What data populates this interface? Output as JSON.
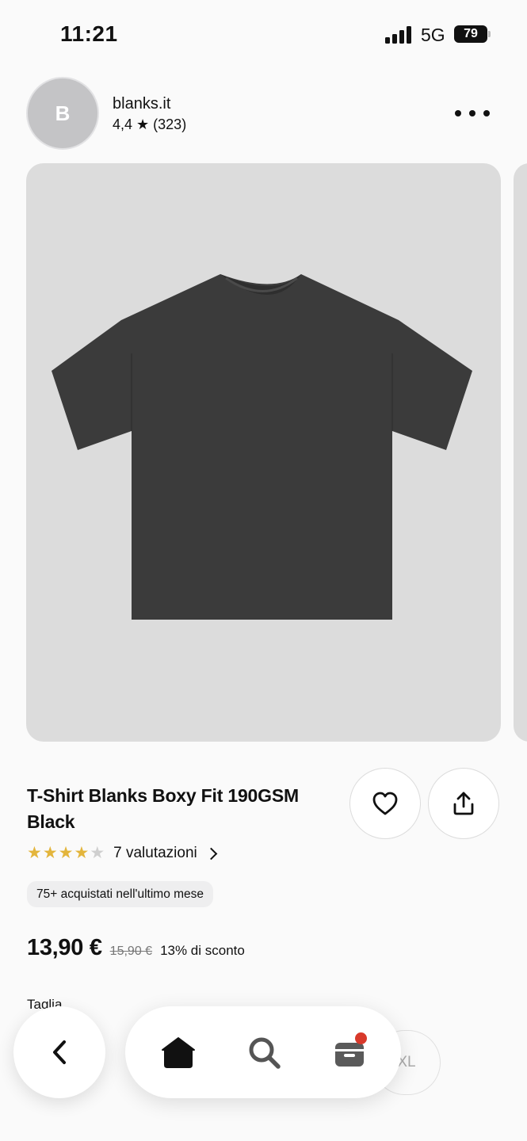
{
  "status_bar": {
    "time": "11:21",
    "network": "5G",
    "battery": "79"
  },
  "seller": {
    "avatar_letter": "B",
    "name": "blanks.it",
    "rating": "4,4 ★ (323)"
  },
  "product": {
    "title": "T-Shirt Blanks Boxy Fit 190GSM Black",
    "stars_filled": 4,
    "stars_total": 5,
    "ratings_link": "7 valutazioni",
    "badge": "75+ acquistati nell'ultimo mese",
    "price": "13,90 €",
    "old_price": "15,90 €",
    "discount": "13% di sconto",
    "size_label": "Taglia",
    "size_option_partial": "XL"
  },
  "colors": {
    "star": "#e3b53c",
    "cart_dot": "#d8392b",
    "image_bg": "#dcdcdc",
    "tshirt": "#3b3b3b"
  },
  "icons": {
    "more": "more-dots-icon",
    "favorite": "heart-icon",
    "share": "share-icon",
    "back": "chevron-left-icon",
    "home": "home-icon",
    "search": "search-icon",
    "cart": "cart-icon"
  }
}
